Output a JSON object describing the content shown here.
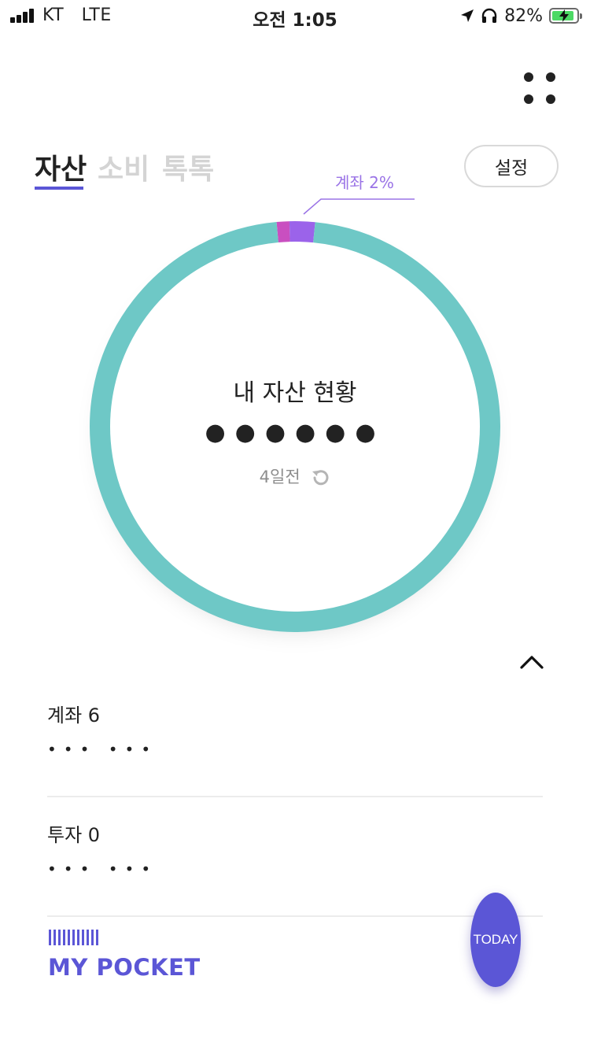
{
  "status_bar": {
    "carrier": "KT",
    "network": "LTE",
    "time": "오전 1:05",
    "battery_percent": "82%"
  },
  "tabs": [
    {
      "label": "자산",
      "active": true
    },
    {
      "label": "소비",
      "active": false
    },
    {
      "label": "톡톡",
      "active": false
    }
  ],
  "settings_label": "설정",
  "donut": {
    "callout_label": "계좌 2%",
    "center_title": "내 자산 현황",
    "masked_amount": "●●●●●●",
    "updated_text": "4일전",
    "segments": [
      {
        "name": "pink",
        "fraction": 0.01,
        "color": "#c94fc0"
      },
      {
        "name": "purple",
        "fraction": 0.02,
        "color": "#9b63ea"
      },
      {
        "name": "teal",
        "fraction": 0.97,
        "color": "#6ec8c6"
      }
    ]
  },
  "sections": [
    {
      "title": "계좌 6",
      "masked": "•••  •••"
    },
    {
      "title": "투자 0",
      "masked": "•••  •••"
    }
  ],
  "pocket_label": "MY POCKET",
  "today_label": "TODAY",
  "colors": {
    "accent": "#5b56d6",
    "teal": "#6ec8c6",
    "callout": "#9a73e6"
  }
}
